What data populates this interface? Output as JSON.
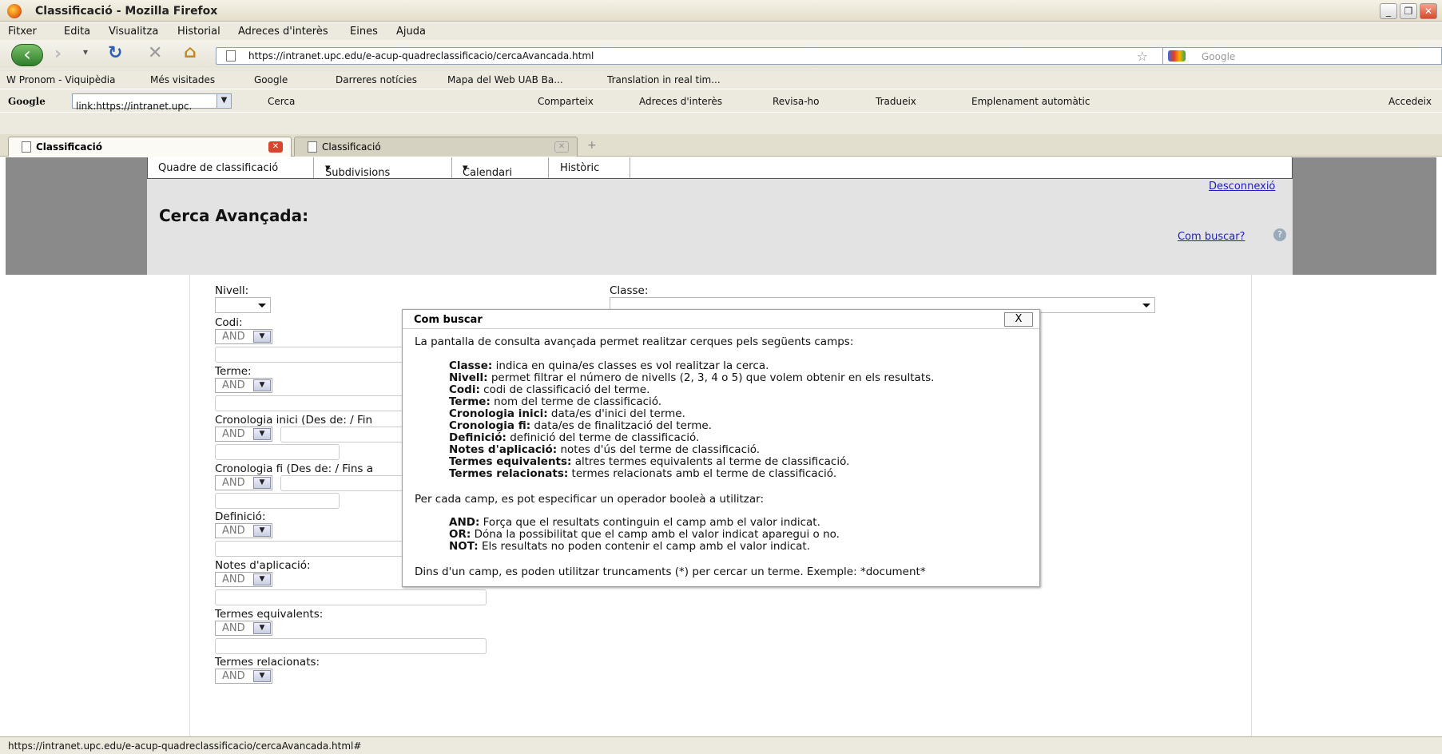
{
  "window": {
    "title": "Classificació - Mozilla Firefox"
  },
  "menu": [
    "Fitxer",
    "Edita",
    "Visualitza",
    "Historial",
    "Adreces d'interès",
    "Eines",
    "Ajuda"
  ],
  "nav": {
    "url": "https://intranet.upc.edu/e-acup-quadreclassificacio/cercaAvancada.html",
    "search_placeholder": "Google"
  },
  "bookmarks": [
    "Pronom - Viquipèdia",
    "Més visitades",
    "Google",
    "Darreres notícies",
    "Mapa del Web UAB Ba...",
    "Translation in real tim..."
  ],
  "google_toolbar": {
    "logo": "Google",
    "query": "link:https://intranet.upc.",
    "items": [
      "Cerca",
      "Comparteix",
      "Adreces d'interès",
      "Revisa-ho",
      "Tradueix",
      "Emplenament automàtic",
      "Accedeix"
    ]
  },
  "tabs": [
    "Classificació",
    "Classificació"
  ],
  "page": {
    "topnav": [
      "Quadre de classificació",
      "Subdivisions",
      "Calendari",
      "Històric"
    ],
    "logout": "Desconnexió",
    "title": "Cerca Avançada:",
    "help_link": "Com buscar?",
    "fields": {
      "nivell": "Nivell:",
      "classe": "Classe:",
      "codi": "Codi:",
      "terme": "Terme:",
      "cron_inici": "Cronologia inici (Des de: / Fin",
      "cron_fi": "Cronologia fi (Des de: / Fins a",
      "definicio": "Definició:",
      "notes": "Notes d'aplicació:",
      "equivalents": "Termes equivalents:",
      "relacionats": "Termes relacionats:"
    },
    "operator": "AND"
  },
  "dialog": {
    "title": "Com buscar",
    "close": "X",
    "intro": "La pantalla de consulta avançada permet realitzar cerques pels següents camps:",
    "fields": [
      {
        "k": "Classe:",
        "v": " indica en quina/es classes es vol realitzar la cerca."
      },
      {
        "k": "Nivell:",
        "v": " permet filtrar el número de nivells (2, 3, 4 o 5) que volem obtenir en els resultats."
      },
      {
        "k": "Codi:",
        "v": " codi de classificació del terme."
      },
      {
        "k": "Terme:",
        "v": " nom del terme de classificació."
      },
      {
        "k": "Cronologia inici:",
        "v": " data/es d'inici del terme."
      },
      {
        "k": "Cronologia fi:",
        "v": " data/es de finalització del terme."
      },
      {
        "k": "Definició:",
        "v": " definició del terme de classificació."
      },
      {
        "k": "Notes d'aplicació:",
        "v": " notes d'ús del terme de classificació."
      },
      {
        "k": "Termes equivalents:",
        "v": " altres termes equivalents al terme de classificació."
      },
      {
        "k": "Termes relacionats:",
        "v": " termes relacionats amb el terme de classificació."
      }
    ],
    "ops_intro": "Per cada camp, es pot especificar un operador booleà a utilitzar:",
    "ops": [
      {
        "k": "AND:",
        "v": " Força que el resultats continguin el camp amb el valor indicat."
      },
      {
        "k": "OR:",
        "v": " Dóna la possibilitat que el camp amb el valor indicat aparegui o no."
      },
      {
        "k": "NOT:",
        "v": " Els resultats no poden contenir el camp amb el valor indicat."
      }
    ],
    "footer": "Dins d'un camp, es poden utilitzar truncaments (*) per cercar un terme. Exemple: *document*"
  },
  "status": "https://intranet.upc.edu/e-acup-quadreclassificacio/cercaAvancada.html#"
}
